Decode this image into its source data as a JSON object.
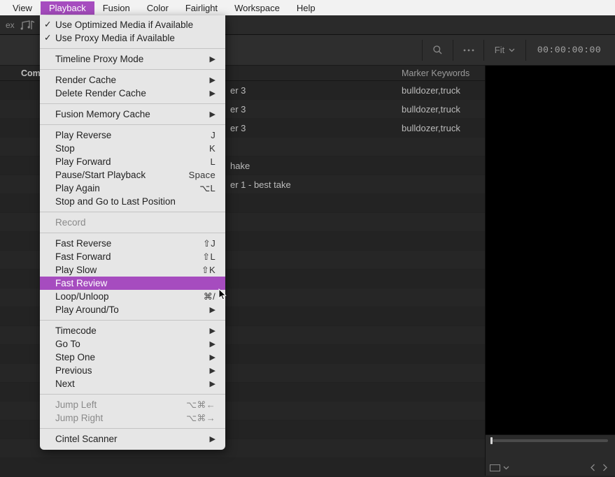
{
  "menubar": {
    "items": [
      {
        "label": "View"
      },
      {
        "label": "Playback"
      },
      {
        "label": "Fusion"
      },
      {
        "label": "Color"
      },
      {
        "label": "Fairlight"
      },
      {
        "label": "Workspace"
      },
      {
        "label": "Help"
      }
    ],
    "active_index": 1
  },
  "toolbar": {
    "ex_label": "ex"
  },
  "strip": {
    "fit_label": "Fit",
    "timecode": "00:00:00:00"
  },
  "panel_header": {
    "comm": "Comm...",
    "keywords": "Marker Keywords"
  },
  "rows": [
    {
      "b": "er 3",
      "c": "bulldozer,truck"
    },
    {
      "b": "er 3",
      "c": "bulldozer,truck"
    },
    {
      "b": "er 3",
      "c": "bulldozer,truck"
    },
    {
      "b": "",
      "c": ""
    },
    {
      "b": "hake",
      "c": ""
    },
    {
      "b": "er 1 - best take",
      "c": ""
    }
  ],
  "dropdown": {
    "groups": [
      [
        {
          "label": "Use Optimized Media if Available",
          "check": true
        },
        {
          "label": "Use Proxy Media if Available",
          "check": true
        }
      ],
      [
        {
          "label": "Timeline Proxy Mode",
          "submenu": true
        }
      ],
      [
        {
          "label": "Render Cache",
          "submenu": true
        },
        {
          "label": "Delete Render Cache",
          "submenu": true
        }
      ],
      [
        {
          "label": "Fusion Memory Cache",
          "submenu": true
        }
      ],
      [
        {
          "label": "Play Reverse",
          "accel": "J"
        },
        {
          "label": "Stop",
          "accel": "K"
        },
        {
          "label": "Play Forward",
          "accel": "L"
        },
        {
          "label": "Pause/Start Playback",
          "accel": "Space"
        },
        {
          "label": "Play Again",
          "accel": "⌥L"
        },
        {
          "label": "Stop and Go to Last Position"
        }
      ],
      [
        {
          "label": "Record",
          "disabled": true
        }
      ],
      [
        {
          "label": "Fast Reverse",
          "accel": "⇧J"
        },
        {
          "label": "Fast Forward",
          "accel": "⇧L"
        },
        {
          "label": "Play Slow",
          "accel": "⇧K"
        },
        {
          "label": "Fast Review",
          "highlight": true
        },
        {
          "label": "Loop/Unloop",
          "accel": "⌘/"
        },
        {
          "label": "Play Around/To",
          "submenu": true
        }
      ],
      [
        {
          "label": "Timecode",
          "submenu": true
        },
        {
          "label": "Go To",
          "submenu": true
        },
        {
          "label": "Step One",
          "submenu": true
        },
        {
          "label": "Previous",
          "submenu": true
        },
        {
          "label": "Next",
          "submenu": true
        }
      ],
      [
        {
          "label": "Jump Left",
          "accel": "⌥⌘←",
          "disabled": true
        },
        {
          "label": "Jump Right",
          "accel": "⌥⌘→",
          "disabled": true
        }
      ],
      [
        {
          "label": "Cintel Scanner",
          "submenu": true
        }
      ]
    ]
  }
}
